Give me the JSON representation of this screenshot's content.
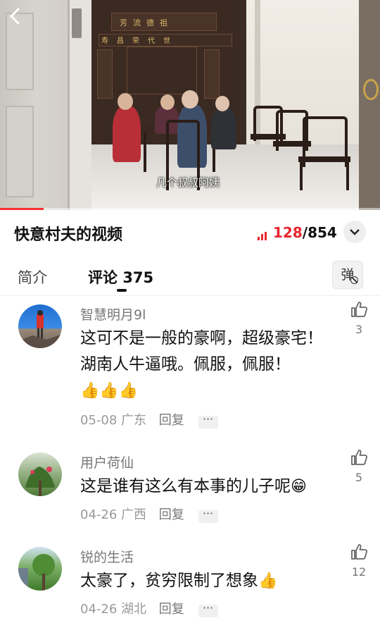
{
  "video": {
    "subtitle": "几个叔叔阿姨",
    "tablet_top": "芳流德祖",
    "tablet_mid": "寿昌荣代世",
    "progress_fraction": 0.115
  },
  "header": {
    "title": "快意村夫的视频",
    "views_current": "128",
    "views_sep": "/",
    "views_total": "854"
  },
  "tabs": {
    "intro": "简介",
    "comments": "评论",
    "comments_count": "375",
    "danmaku": "弹"
  },
  "comments": [
    {
      "username": "智慧明月9l",
      "text": "这可不是一般的豪啊，超级豪宅！湖南人牛逼哦。佩服，佩服！",
      "emoji": "👍👍👍",
      "date": "05-08",
      "location": "广东",
      "reply": "回复",
      "likes": "3"
    },
    {
      "username": "用户荷仙",
      "text": "这是谁有这么有本事的儿子呢",
      "emoji": "😁",
      "date": "04-26",
      "location": "广西",
      "reply": "回复",
      "likes": "5"
    },
    {
      "username": "锐的生活",
      "text": "太豪了，贫穷限制了想象",
      "emoji": "👍",
      "date": "04-26",
      "location": "湖北",
      "reply": "回复",
      "likes": "12"
    }
  ],
  "colors": {
    "accent": "#e8262e",
    "progress": "#ff3030"
  }
}
